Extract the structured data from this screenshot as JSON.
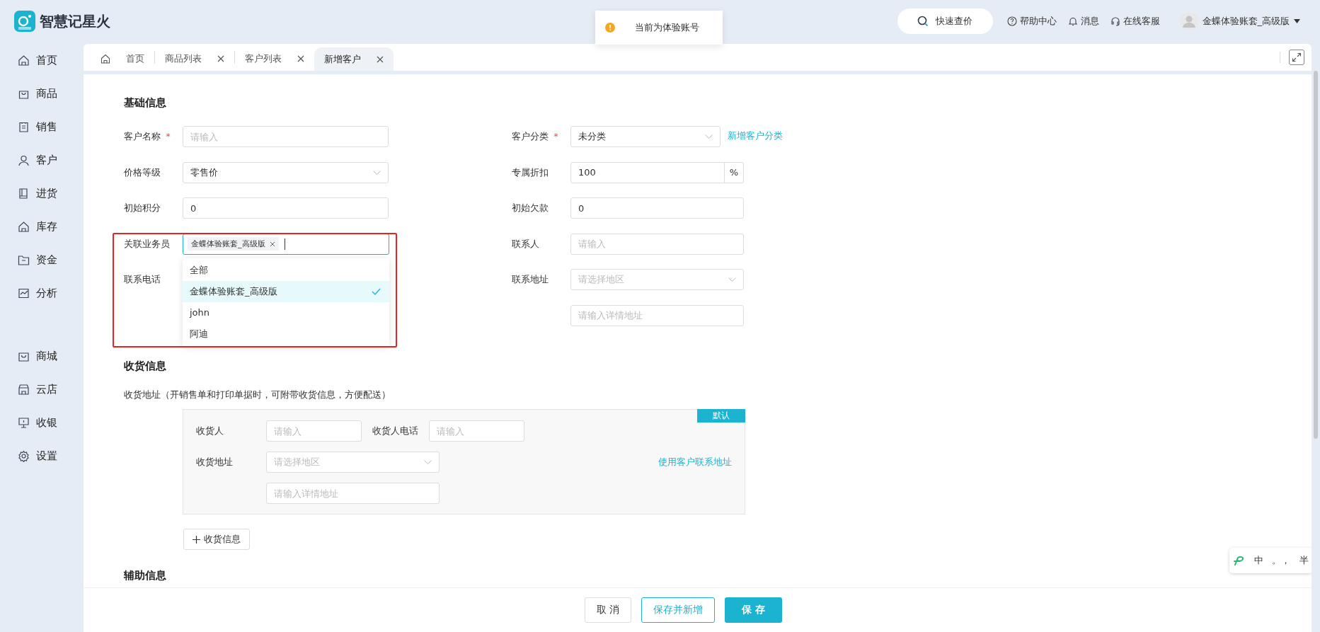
{
  "app": {
    "name": "智慧记星火"
  },
  "toast": {
    "text": "当前为体验账号"
  },
  "header": {
    "search": "快速查价",
    "links": [
      {
        "kind": "help",
        "label": "帮助中心"
      },
      {
        "kind": "bell",
        "label": "消息"
      },
      {
        "kind": "headset",
        "label": "在线客服"
      }
    ],
    "user": "金蝶体验账套_高级版"
  },
  "sidebar": {
    "groups": [
      [
        {
          "label": "首页"
        },
        {
          "label": "商品"
        },
        {
          "label": "销售"
        },
        {
          "label": "客户"
        },
        {
          "label": "进货"
        },
        {
          "label": "库存"
        },
        {
          "label": "资金"
        },
        {
          "label": "分析"
        }
      ],
      [
        {
          "label": "商城"
        },
        {
          "label": "云店"
        },
        {
          "label": "收银"
        },
        {
          "label": "设置"
        }
      ]
    ]
  },
  "tabs": [
    {
      "label": "首页",
      "kind": "home",
      "selected": false
    },
    {
      "label": "商品列表",
      "kind": "closable",
      "selected": false
    },
    {
      "label": "客户列表",
      "kind": "closable",
      "selected": false
    },
    {
      "label": "新增客户",
      "kind": "closable",
      "selected": true
    }
  ],
  "basic": {
    "title": "基础信息",
    "left": [
      {
        "label": "客户名称",
        "required_mark": "*",
        "kind": "input",
        "placeholder": "请输入"
      },
      {
        "label": "价格等级",
        "kind": "select",
        "value": "零售价"
      },
      {
        "label": "初始积分",
        "kind": "input",
        "value": "0"
      },
      {
        "label": "关联业务员",
        "kind": "tags",
        "tags": [
          "金蝶体验账套_高级版"
        ],
        "options": [
          {
            "label": "全部",
            "selected": false
          },
          {
            "label": "金蝶体验账套_高级版",
            "selected": true
          },
          {
            "label": "john",
            "selected": false
          },
          {
            "label": "阿迪",
            "selected": false
          }
        ]
      },
      {
        "label": "联系电话",
        "kind": "hidden"
      }
    ],
    "right": [
      {
        "label": "客户分类",
        "required_mark": "*",
        "kind": "select",
        "value": "未分类",
        "link": "新增客户分类"
      },
      {
        "label": "专属折扣",
        "kind": "suffix",
        "value": "100",
        "suffix": "%"
      },
      {
        "label": "初始欠款",
        "kind": "input",
        "value": "0"
      },
      {
        "label": "联系人",
        "kind": "input",
        "placeholder": "请输入"
      },
      {
        "label": "联系地址",
        "kind": "select",
        "placeholder": "请选择地区"
      },
      {
        "kind": "input",
        "placeholder": "请输入详情地址"
      }
    ]
  },
  "shipping": {
    "title": "收货信息",
    "note": "收货地址（开销售单和打印单据时，可附带收货信息，方便配送）",
    "card": {
      "badge": "默认",
      "receiver_label": "收货人",
      "receiver_placeholder": "请输入",
      "phone_label": "收货人电话",
      "phone_placeholder": "请输入",
      "address_label": "收货地址",
      "region_placeholder": "请选择地区",
      "detail_placeholder": "请输入详情地址",
      "use_contact_link": "使用客户联系地址"
    },
    "add_button": "收货信息"
  },
  "aux": {
    "title": "辅助信息"
  },
  "footer": {
    "buttons": [
      {
        "label": "取 消",
        "kind": "plain"
      },
      {
        "label": "保存并新增",
        "kind": "outline"
      },
      {
        "label": "保 存",
        "kind": "primary"
      }
    ]
  },
  "ime": {
    "items": [
      "中",
      "。，",
      "半"
    ]
  }
}
